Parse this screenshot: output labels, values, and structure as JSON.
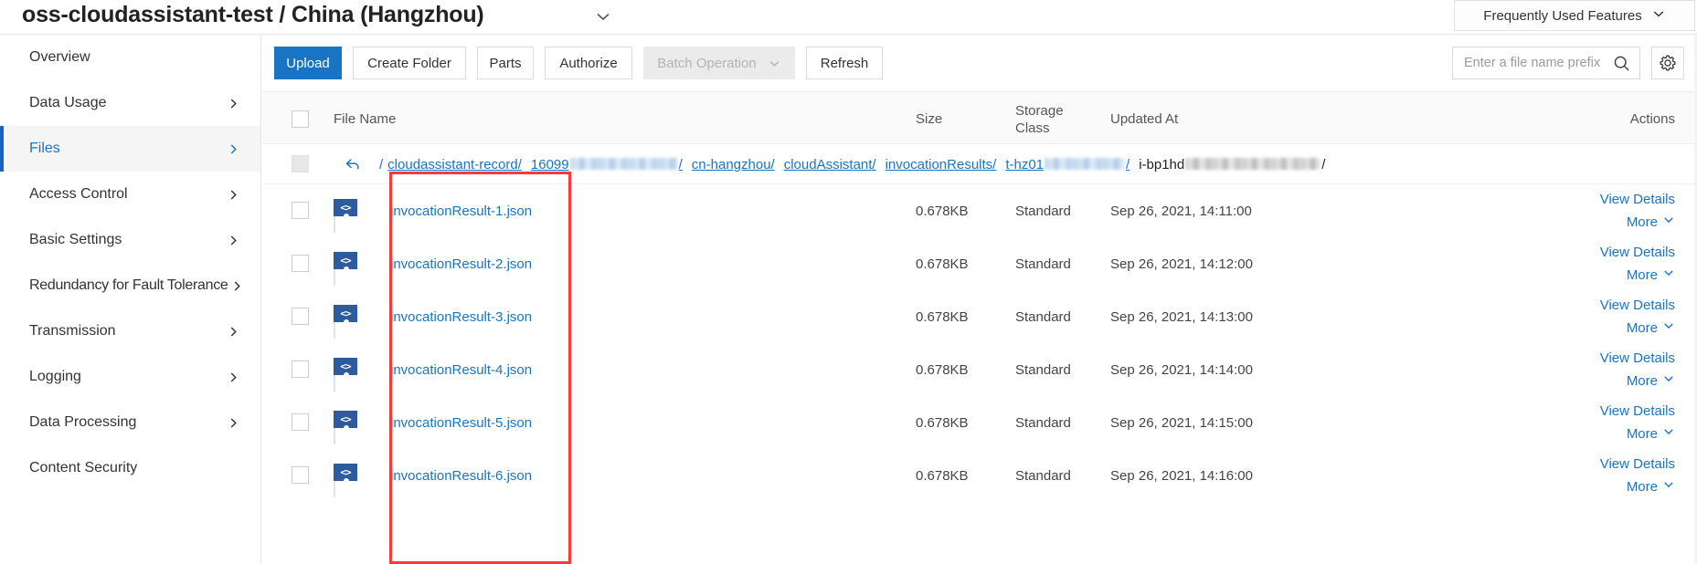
{
  "topbar": {
    "bucket_title": "oss-cloudassistant-test / China (Hangzhou)",
    "bucket_caret_icon": "chevron-down-icon",
    "frequently_used_features_label": "Frequently Used Features",
    "frequently_used_features_icon": "chevron-down-icon"
  },
  "sidebar": {
    "items": [
      {
        "label": "Overview",
        "chevron": false,
        "active": false
      },
      {
        "label": "Data Usage",
        "chevron": true,
        "active": false
      },
      {
        "label": "Files",
        "chevron": true,
        "active": true
      },
      {
        "label": "Access Control",
        "chevron": true,
        "active": false
      },
      {
        "label": "Basic Settings",
        "chevron": true,
        "active": false
      },
      {
        "label": "Redundancy for Fault Tolerance",
        "chevron": true,
        "active": false
      },
      {
        "label": "Transmission",
        "chevron": true,
        "active": false
      },
      {
        "label": "Logging",
        "chevron": true,
        "active": false
      },
      {
        "label": "Data Processing",
        "chevron": true,
        "active": false
      },
      {
        "label": "Content Security",
        "chevron": false,
        "active": false
      }
    ]
  },
  "toolbar": {
    "upload_label": "Upload",
    "create_folder_label": "Create Folder",
    "parts_label": "Parts",
    "authorize_label": "Authorize",
    "batch_operation_label": "Batch Operation",
    "batch_operation_disabled": true,
    "batch_operation_icon": "chevron-down-icon",
    "refresh_label": "Refresh",
    "search_placeholder": "Enter a file name prefix",
    "search_value": "",
    "search_icon": "search-icon",
    "settings_icon": "gear-icon",
    "primary_color": "#1a74c4"
  },
  "table": {
    "headers": {
      "file_name": "File Name",
      "size": "Size",
      "storage_class_line1": "Storage",
      "storage_class_line2": "Class",
      "updated_at": "Updated At",
      "actions": "Actions"
    },
    "breadcrumb": {
      "back_icon": "back-arrow-icon",
      "leading_separator": "/",
      "segments": [
        {
          "text": "cloudassistant-record/",
          "link": true,
          "blurred": false
        },
        {
          "text": "16099",
          "link": true,
          "blurred": true,
          "blur_width": 118,
          "suffix": "/"
        },
        {
          "text": "cn-hangzhou/",
          "link": true,
          "blurred": false
        },
        {
          "text": "cloudAssistant/",
          "link": true,
          "blurred": false
        },
        {
          "text": "invocationResults/",
          "link": true,
          "blurred": false
        },
        {
          "text": "t-hz01",
          "link": true,
          "blurred": true,
          "blur_width": 88,
          "suffix": "/"
        },
        {
          "text": "i-bp1hd",
          "link": false,
          "blurred": true,
          "blur_width": 148,
          "suffix": "/"
        }
      ]
    },
    "rows": [
      {
        "file_icon": "code-file-icon",
        "name": "invocationResult-1.json",
        "size": "0.678KB",
        "storage_class": "Standard",
        "updated_at": "Sep 26, 2021, 14:11:00",
        "view_details": "View Details",
        "more": "More",
        "more_icon": "chevron-down-icon"
      },
      {
        "file_icon": "code-file-icon",
        "name": "invocationResult-2.json",
        "size": "0.678KB",
        "storage_class": "Standard",
        "updated_at": "Sep 26, 2021, 14:12:00",
        "view_details": "View Details",
        "more": "More",
        "more_icon": "chevron-down-icon"
      },
      {
        "file_icon": "code-file-icon",
        "name": "invocationResult-3.json",
        "size": "0.678KB",
        "storage_class": "Standard",
        "updated_at": "Sep 26, 2021, 14:13:00",
        "view_details": "View Details",
        "more": "More",
        "more_icon": "chevron-down-icon"
      },
      {
        "file_icon": "code-file-icon",
        "name": "invocationResult-4.json",
        "size": "0.678KB",
        "storage_class": "Standard",
        "updated_at": "Sep 26, 2021, 14:14:00",
        "view_details": "View Details",
        "more": "More",
        "more_icon": "chevron-down-icon"
      },
      {
        "file_icon": "code-file-icon",
        "name": "invocationResult-5.json",
        "size": "0.678KB",
        "storage_class": "Standard",
        "updated_at": "Sep 26, 2021, 14:15:00",
        "view_details": "View Details",
        "more": "More",
        "more_icon": "chevron-down-icon"
      },
      {
        "file_icon": "code-file-icon",
        "name": "invocationResult-6.json",
        "size": "0.678KB",
        "storage_class": "Standard",
        "updated_at": "Sep 26, 2021, 14:16:00",
        "view_details": "View Details",
        "more": "More",
        "more_icon": "chevron-down-icon"
      }
    ]
  },
  "annotation": {
    "highlight_color": "#f93a3a",
    "highlight_target": "file-name-column"
  }
}
